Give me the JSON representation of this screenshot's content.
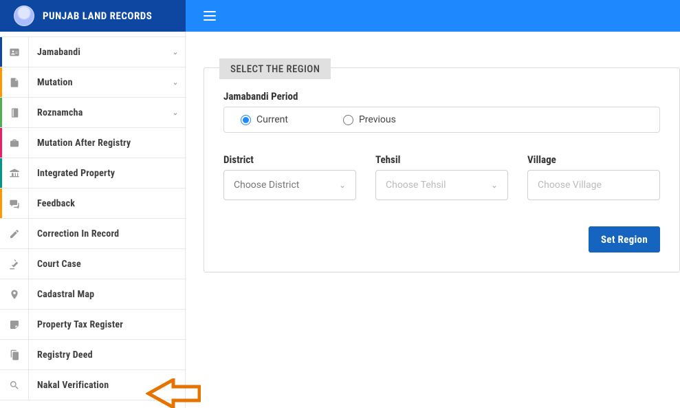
{
  "brand": {
    "title": "PUNJAB LAND RECORDS"
  },
  "sidebar": {
    "items": [
      {
        "label": "Jamabandi",
        "icon": "id-card",
        "expandable": true,
        "edge": "blue"
      },
      {
        "label": "Mutation",
        "icon": "file",
        "expandable": true,
        "edge": "orange"
      },
      {
        "label": "Roznamcha",
        "icon": "book",
        "expandable": true,
        "edge": "green"
      },
      {
        "label": "Mutation After Registry",
        "icon": "briefcase",
        "expandable": false,
        "edge": "pink"
      },
      {
        "label": "Integrated Property",
        "icon": "institution",
        "expandable": false,
        "edge": "teal"
      },
      {
        "label": "Feedback",
        "icon": "comments",
        "expandable": false,
        "edge": "orange"
      },
      {
        "label": "Correction In Record",
        "icon": "edit",
        "expandable": false,
        "edge": ""
      },
      {
        "label": "Court Case",
        "icon": "gavel",
        "expandable": false,
        "edge": ""
      },
      {
        "label": "Cadastral Map",
        "icon": "marker",
        "expandable": false,
        "edge": ""
      },
      {
        "label": "Property Tax Register",
        "icon": "note",
        "expandable": false,
        "edge": ""
      },
      {
        "label": "Registry Deed",
        "icon": "copy",
        "expandable": false,
        "edge": ""
      },
      {
        "label": "Nakal Verification",
        "icon": "search",
        "expandable": false,
        "edge": ""
      }
    ]
  },
  "panel": {
    "legend": "SELECT THE REGION",
    "period_label": "Jamabandi Period",
    "radios": {
      "current": "Current",
      "previous": "Previous",
      "selected": "current"
    },
    "fields": {
      "district": {
        "label": "District",
        "placeholder": "Choose District"
      },
      "tehsil": {
        "label": "Tehsil",
        "placeholder": "Choose Tehsil"
      },
      "village": {
        "label": "Village",
        "placeholder": "Choose Village"
      }
    },
    "submit_label": "Set Region"
  }
}
